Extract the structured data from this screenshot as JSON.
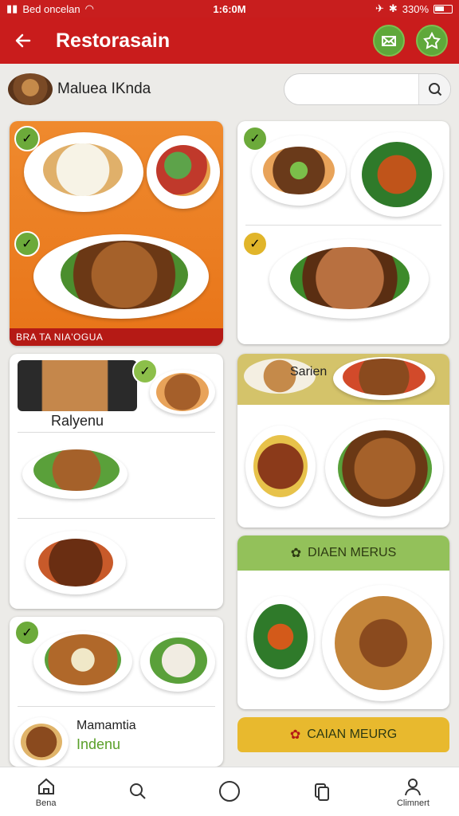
{
  "status": {
    "carrier": "Bed oncelan",
    "time": "1:6:0M",
    "battery": "330%"
  },
  "app": {
    "title": "Restorasain",
    "restaurant_name": "Maluea IKnda",
    "search_placeholder": ""
  },
  "cards": {
    "c1_banner": "BRA TA NIA'OGUA",
    "c3_label": "Ralyenu",
    "c4_label": "Sarien",
    "c6_banner": "DIAEN MERUS",
    "c7_label_1": "Mamamtia",
    "c7_label_2": "Indenu",
    "c8_banner": "CAIAN MEURG"
  },
  "nav": {
    "home": "Bena",
    "search": "",
    "circle": "",
    "orders": "",
    "account": "Climnert"
  },
  "colors": {
    "primary": "#c91c1c",
    "accent_green": "#6caa3a",
    "accent_orange": "#e87418",
    "accent_yellow": "#e8b92e"
  }
}
